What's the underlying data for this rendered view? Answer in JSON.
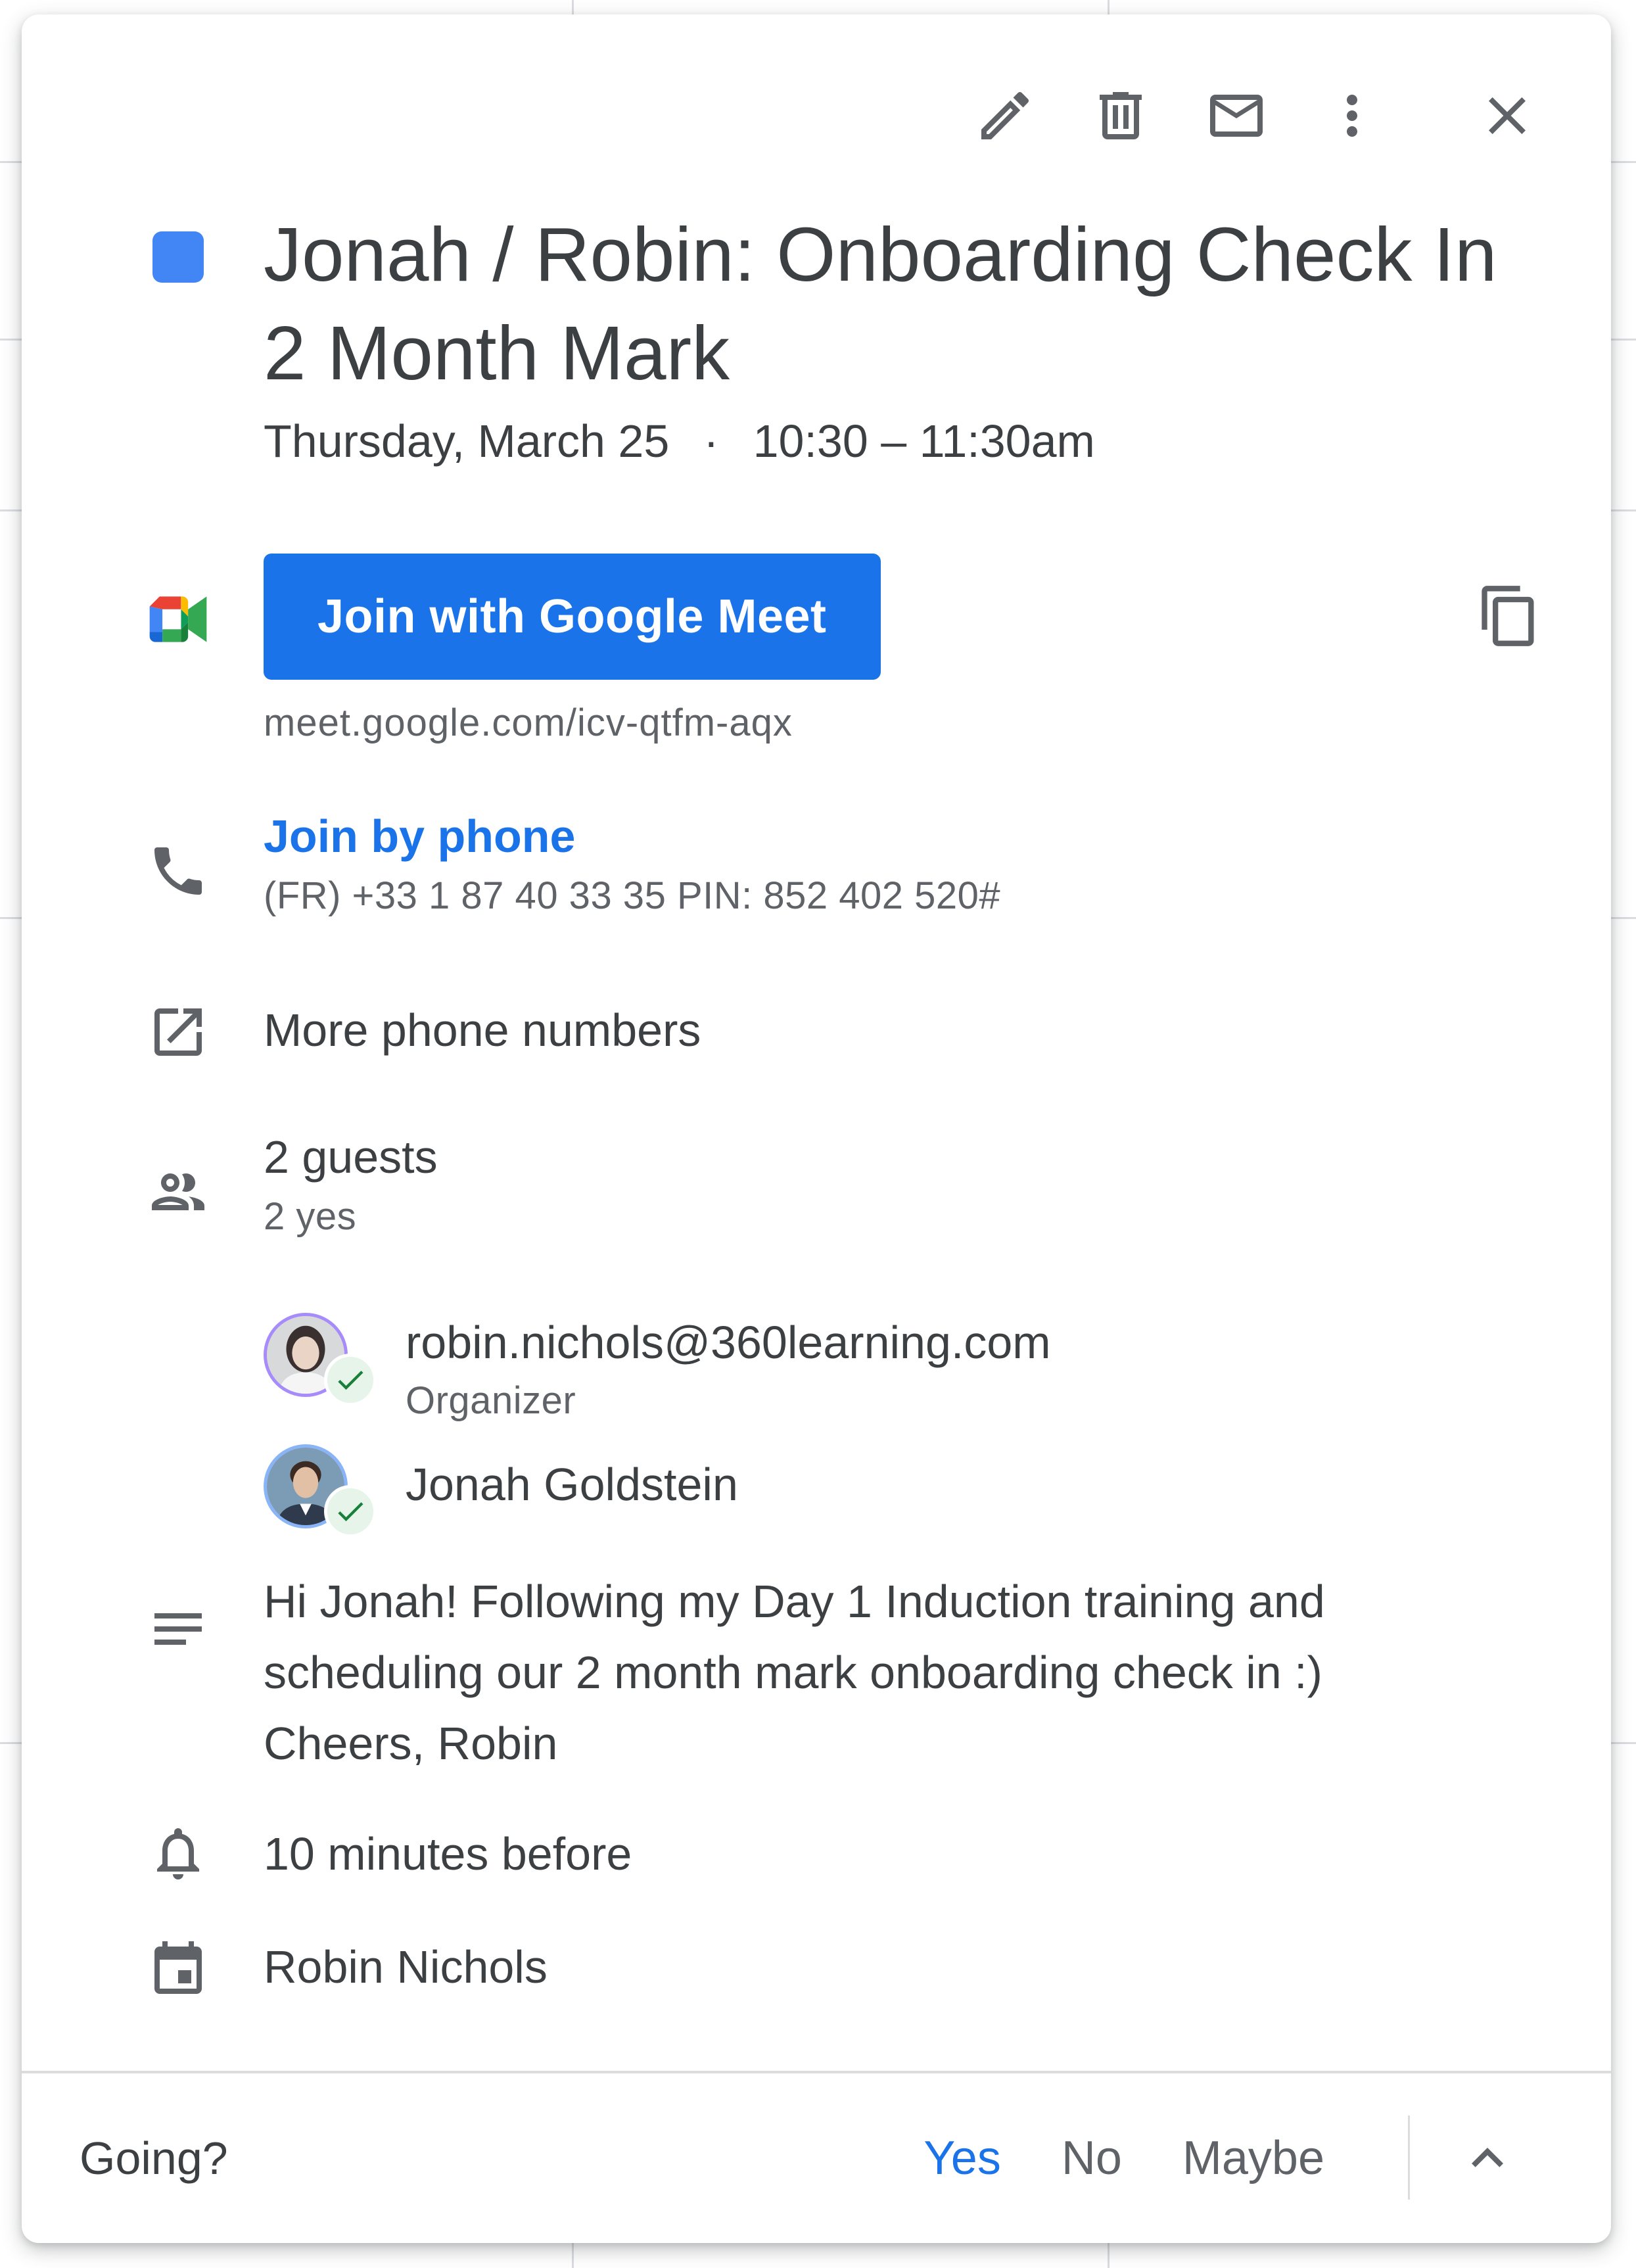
{
  "toolbar": {
    "edit_icon": "pencil-icon",
    "delete_icon": "trash-icon",
    "email_icon": "mail-icon",
    "more_icon": "more-vert-icon",
    "close_icon": "close-icon"
  },
  "event": {
    "color": "#4285f4",
    "title_line1": "Jonah / Robin: Onboarding Check In",
    "title_line2": "2 Month Mark",
    "date": "Thursday, March 25",
    "separator": "·",
    "time": "10:30 – 11:30am"
  },
  "meet": {
    "button_label": "Join with Google Meet",
    "url": "meet.google.com/icv-qtfm-aqx"
  },
  "phone": {
    "link_label": "Join by phone",
    "details": "(FR) +33 1 87 40 33 35 PIN: 852 402 520#"
  },
  "more_numbers": {
    "label": "More phone numbers"
  },
  "guests": {
    "count_label": "2 guests",
    "summary": "2 yes",
    "list": [
      {
        "name": "robin.nichols@360learning.com",
        "role": "Organizer"
      },
      {
        "name": "Jonah Goldstein",
        "role": ""
      }
    ]
  },
  "description": {
    "line1": "Hi Jonah! Following my Day 1 Induction training and",
    "line2": "scheduling our 2 month mark onboarding check in :)",
    "line3": "Cheers, Robin"
  },
  "reminder": {
    "label": "10 minutes before"
  },
  "calendar": {
    "owner": "Robin Nichols"
  },
  "footer": {
    "going_label": "Going?",
    "yes": "Yes",
    "no": "No",
    "maybe": "Maybe",
    "accent_color": "#1a73e8"
  }
}
